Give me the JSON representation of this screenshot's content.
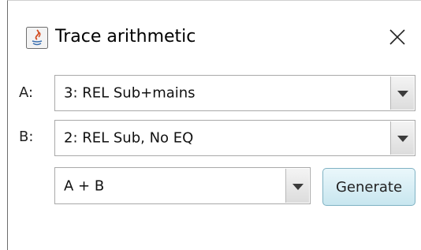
{
  "window": {
    "title": "Trace arithmetic"
  },
  "icons": {
    "app": "java-icon",
    "close": "close-icon",
    "dropdown": "chevron-down-icon"
  },
  "row_a": {
    "label": "A:",
    "selected": "3: REL Sub+mains"
  },
  "row_b": {
    "label": "B:",
    "selected": "2: REL Sub, No EQ"
  },
  "operation": {
    "selected": "A + B"
  },
  "generate_button": {
    "label": "Generate"
  },
  "colors": {
    "button_top": "#eaf7fb",
    "button_bottom": "#c8e6ef",
    "button_border": "#7fb2c3",
    "combo_border": "#a9a9a9"
  }
}
